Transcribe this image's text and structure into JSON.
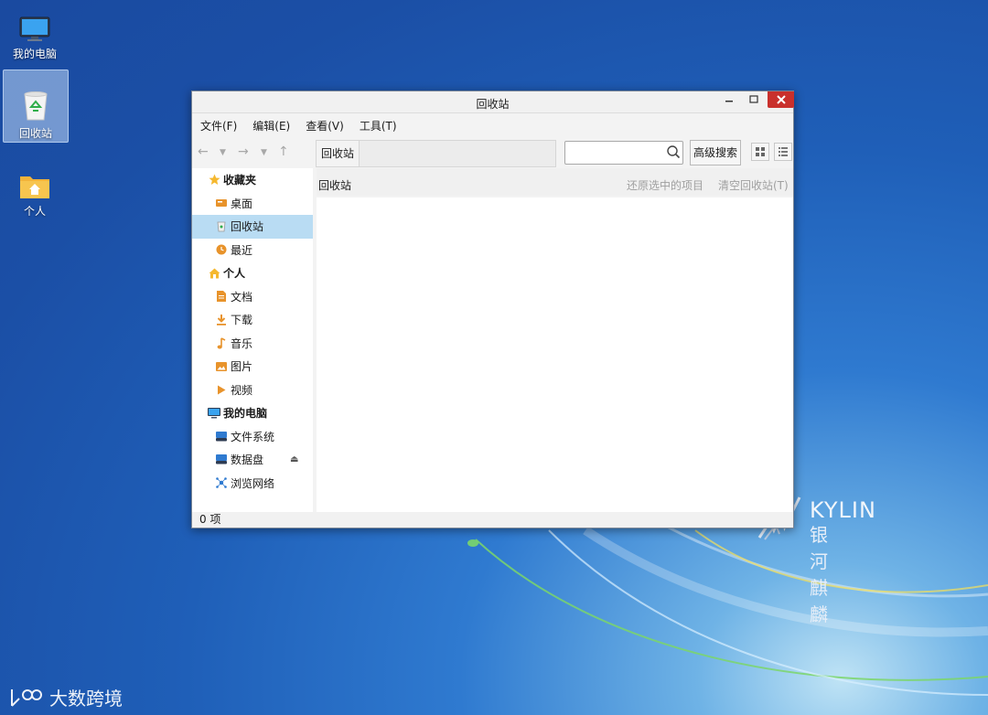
{
  "desktop": {
    "icons": [
      {
        "label": "我的电脑"
      },
      {
        "label": "回收站"
      },
      {
        "label": "个人"
      }
    ],
    "brand": {
      "en": "KYLIN",
      "cn": "银河麒麟"
    },
    "watermark": "大数跨境"
  },
  "window": {
    "title": "回收站",
    "menu": [
      "文件(F)",
      "编辑(E)",
      "查看(V)",
      "工具(T)"
    ],
    "address_crumb": "回收站",
    "search_placeholder": "",
    "advanced_search_label": "高级搜索",
    "sidebar": {
      "favorites_header": "收藏夹",
      "favorites": [
        "桌面",
        "回收站",
        "最近"
      ],
      "personal_header": "个人",
      "personal": [
        "文档",
        "下载",
        "音乐",
        "图片",
        "视频"
      ],
      "computer_header": "我的电脑",
      "computer": [
        "文件系统",
        "数据盘",
        "浏览网络"
      ]
    },
    "content": {
      "location_label": "回收站",
      "restore_label": "还原选中的项目",
      "empty_label": "清空回收站(T)"
    },
    "status": "0 项"
  },
  "colors": {
    "active_sidebar": "#b9dcf3",
    "close_button": "#c9302c",
    "accent_orange": "#e8932b"
  }
}
